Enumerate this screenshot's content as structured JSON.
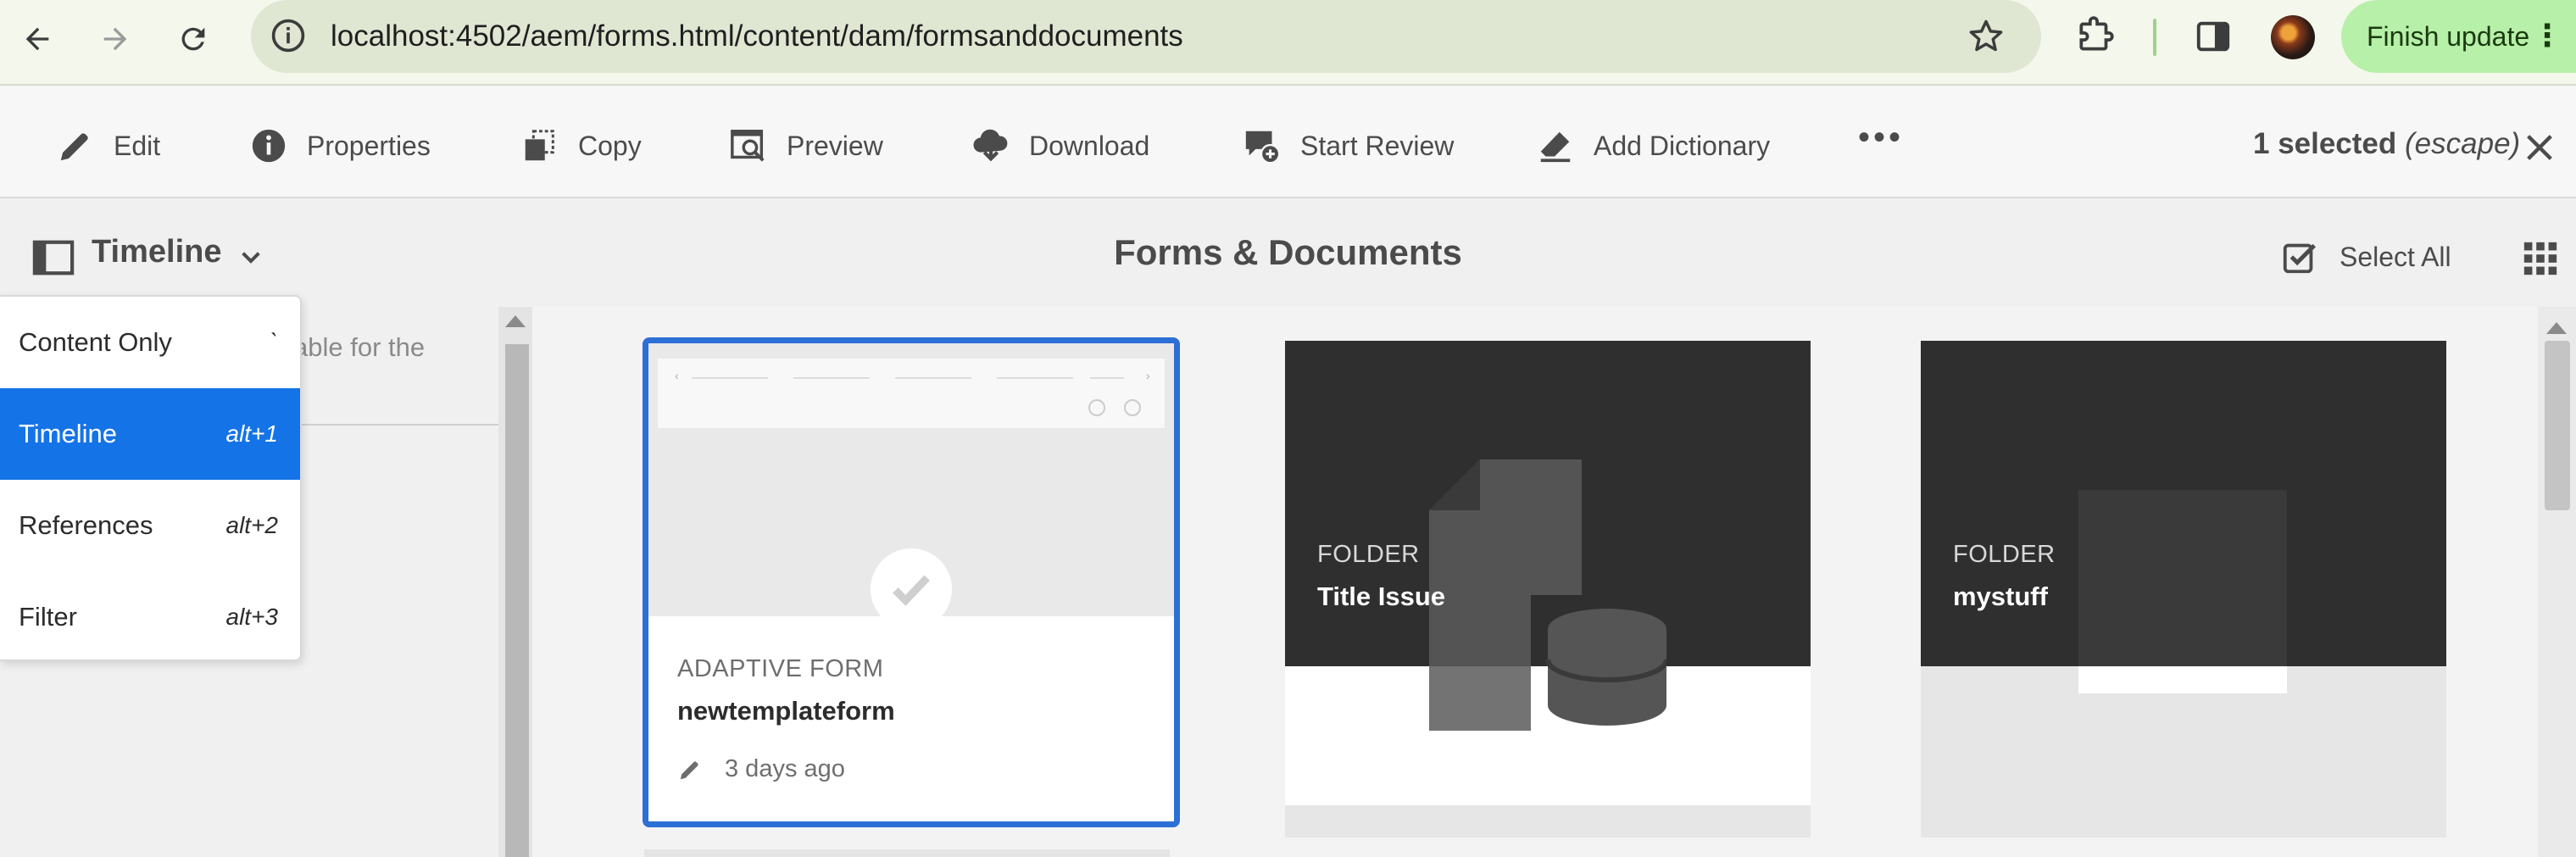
{
  "browser": {
    "url": "localhost:4502/aem/forms.html/content/dam/formsanddocuments",
    "finish_update_label": "Finish update"
  },
  "actionbar": {
    "actions": [
      {
        "label": "Edit",
        "icon": "pencil-icon"
      },
      {
        "label": "Properties",
        "icon": "info-icon"
      },
      {
        "label": "Copy",
        "icon": "copy-icon"
      },
      {
        "label": "Preview",
        "icon": "preview-icon"
      },
      {
        "label": "Download",
        "icon": "download-icon"
      },
      {
        "label": "Start Review",
        "icon": "review-icon"
      },
      {
        "label": "Add Dictionary",
        "icon": "eraser-icon"
      }
    ],
    "more_label": "•••",
    "selected_count": "1 selected",
    "escape_hint": "(escape)"
  },
  "header": {
    "rail_view": "Timeline",
    "page_title": "Forms & Documents",
    "select_all_label": "Select All"
  },
  "rail": {
    "description_partial": "able for the"
  },
  "view_menu": {
    "items": [
      {
        "label": "Content Only",
        "shortcut": "`",
        "active": false
      },
      {
        "label": "Timeline",
        "shortcut": "alt+1",
        "active": true
      },
      {
        "label": "References",
        "shortcut": "alt+2",
        "active": false
      },
      {
        "label": "Filter",
        "shortcut": "alt+3",
        "active": false
      }
    ]
  },
  "cards": [
    {
      "type": "ADAPTIVE FORM",
      "name": "newtemplateform",
      "modified": "3 days ago",
      "selected": true
    },
    {
      "type": "FOLDER",
      "name": "Title Issue",
      "selected": false
    },
    {
      "type": "FOLDER",
      "name": "mystuff",
      "selected": false
    }
  ],
  "colors": {
    "accent": "#1473e6",
    "selection_border": "#2c6fd6",
    "folder_dark": "#2f2f2f",
    "update_button": "#b7f0a8"
  }
}
